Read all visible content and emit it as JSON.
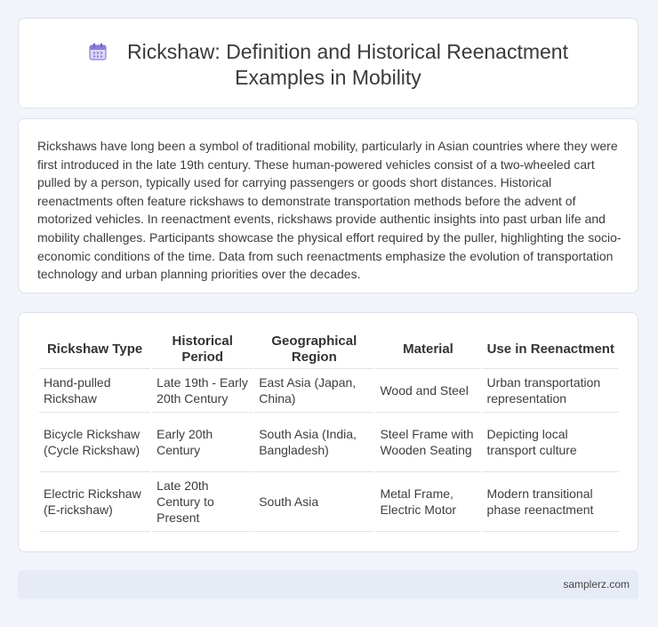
{
  "header": {
    "icon": "calendar-icon",
    "title_line1": "Rickshaw: Definition and Historical Reenactment",
    "title_line2": "Examples in Mobility"
  },
  "intro": {
    "text": "Rickshaws have long been a symbol of traditional mobility, particularly in Asian countries where they were first introduced in the late 19th century. These human-powered vehicles consist of a two-wheeled cart pulled by a person, typically used for carrying passengers or goods short distances. Historical reenactments often feature rickshaws to demonstrate transportation methods before the advent of motorized vehicles. In reenactment events, rickshaws provide authentic insights into past urban life and mobility challenges. Participants showcase the physical effort required by the puller, highlighting the socio-economic conditions of the time. Data from such reenactments emphasize the evolution of transportation technology and urban planning priorities over the decades."
  },
  "table": {
    "headers": [
      "Rickshaw Type",
      "Historical Period",
      "Geographical Region",
      "Material",
      "Use in Reenactment"
    ],
    "rows": [
      [
        "Hand-pulled Rickshaw",
        "Late 19th - Early 20th Century",
        "East Asia (Japan, China)",
        "Wood and Steel",
        "Urban transportation representation"
      ],
      [
        "Bicycle Rickshaw (Cycle Rickshaw)",
        "Early 20th Century",
        "South Asia (India, Bangladesh)",
        "Steel Frame with Wooden Seating",
        "Depicting local transport culture"
      ],
      [
        "Electric Rickshaw (E-rickshaw)",
        "Late 20th Century to Present",
        "South Asia",
        "Metal Frame, Electric Motor",
        "Modern transitional phase reenactment"
      ]
    ]
  },
  "footer": {
    "site": "samplerz.com"
  }
}
